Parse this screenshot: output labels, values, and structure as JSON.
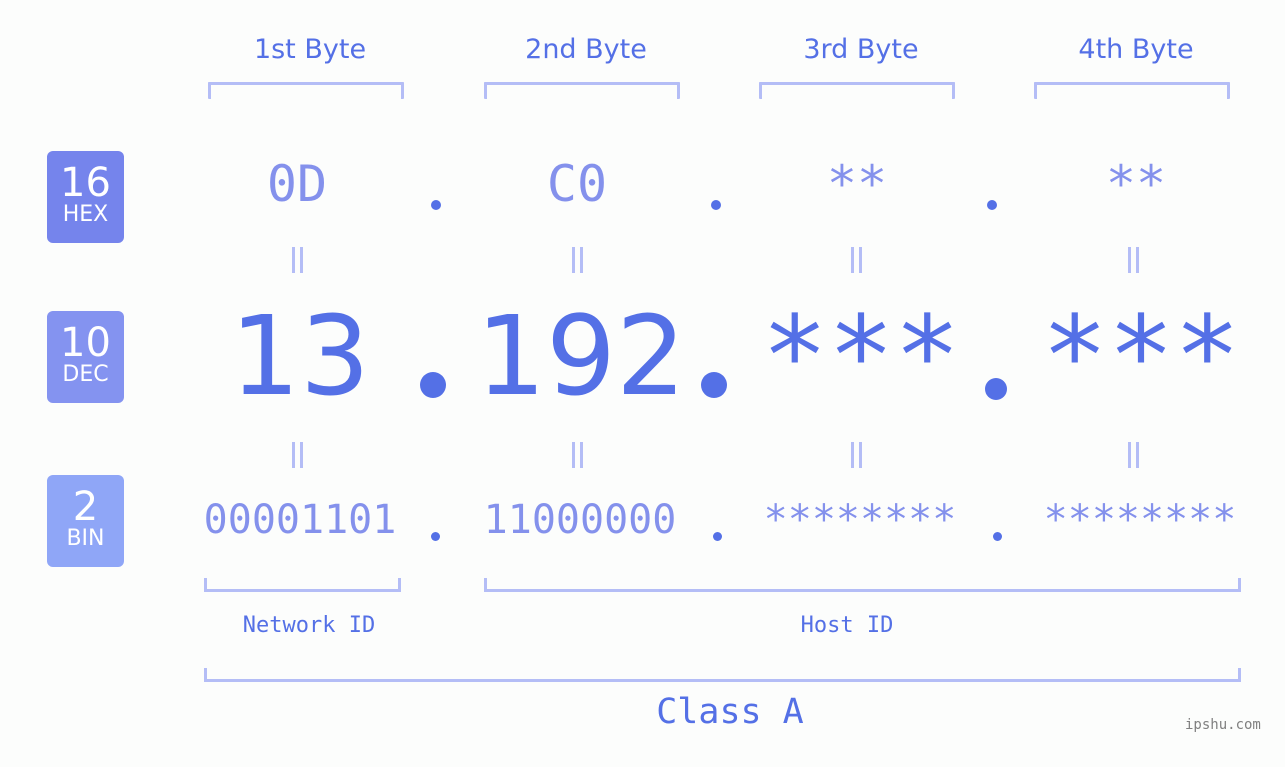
{
  "byte_headers": [
    "1st Byte",
    "2nd Byte",
    "3rd Byte",
    "4th Byte"
  ],
  "badges": [
    {
      "base": "16",
      "label": "HEX",
      "color": "#7584ec"
    },
    {
      "base": "10",
      "label": "DEC",
      "color": "#8493f0"
    },
    {
      "base": "2",
      "label": "BIN",
      "color": "#8fa6f7"
    }
  ],
  "hex": [
    "0D",
    "C0",
    "**",
    "**"
  ],
  "dec": [
    "13",
    "192",
    "***",
    "***"
  ],
  "bin": [
    "00001101",
    "11000000",
    "********",
    "********"
  ],
  "separator": ".",
  "network_label": "Network ID",
  "host_label": "Host ID",
  "class_label": "Class A",
  "watermark": "ipshu.com",
  "colors": {
    "accent": "#5470e6",
    "light": "#8491ec",
    "bracket": "#b4bdf6",
    "background": "#fcfdfc"
  }
}
